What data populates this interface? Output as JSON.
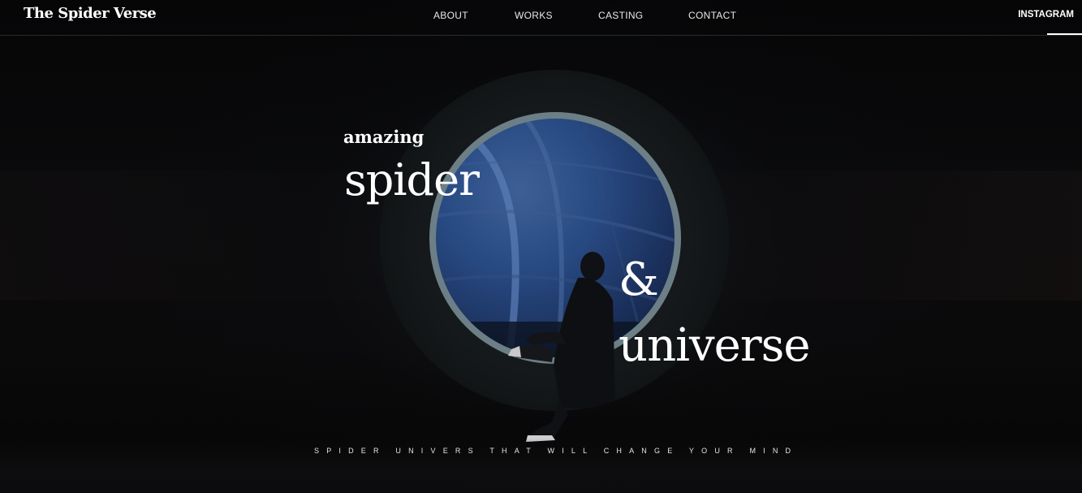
{
  "header": {
    "logo": "The Spider Verse",
    "nav": [
      "ABOUT",
      "WORKS",
      "CASTING",
      "CONTACT"
    ],
    "instagram": "INSTAGRAM"
  },
  "hero": {
    "amazing": "amazing",
    "spider": "spider",
    "ampersand": "&",
    "universe": "universe",
    "tagline": "SPIDER UNIVERS THAT WILL CHANGE YOUR MIND"
  },
  "colors": {
    "background": "#050506",
    "text": "#ffffff",
    "portal_blue": "#284a83",
    "ring": "#6d7f86"
  }
}
